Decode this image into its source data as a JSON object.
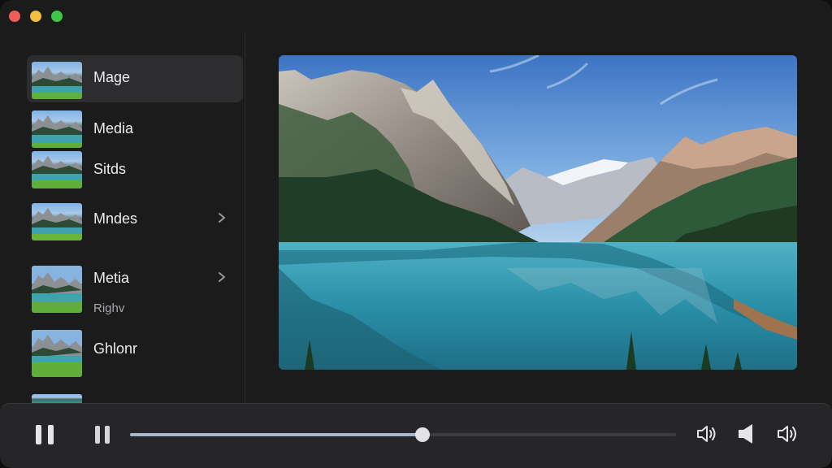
{
  "sidebar": {
    "items": [
      {
        "label": "Mage",
        "selected": true,
        "chevron": false,
        "thumb_icon": "mountain-lake-thumbnail"
      },
      {
        "label": "Media",
        "selected": false,
        "chevron": false,
        "thumb_icon": "mountain-lake-thumbnail"
      },
      {
        "label": "Sitds",
        "selected": false,
        "chevron": false,
        "thumb_icon": "mountain-lake-thumbnail"
      },
      {
        "label": "Mndes",
        "selected": false,
        "chevron": true,
        "thumb_icon": "mountain-lake-thumbnail"
      },
      {
        "label": "Metia",
        "sublabel": "Righv",
        "selected": false,
        "chevron": true,
        "thumb_icon": "mountain-lake-thumbnail"
      },
      {
        "label": "Ghlonr",
        "selected": false,
        "chevron": false,
        "thumb_icon": "mountain-lake-thumbnail"
      }
    ],
    "chevron_icon": "chevron-right-icon"
  },
  "viewer": {
    "image": "mountain-lake-landscape"
  },
  "player": {
    "progress": 0.536,
    "icons": [
      "play-pause-icon",
      "pause-icon",
      "volume-low-icon",
      "speaker-icon",
      "volume-high-icon"
    ]
  },
  "colors": {
    "window_bg": "#1b1b1c",
    "selected_bg": "#2d2d2f",
    "control_bar": "#262628",
    "seek_fill": "#a7b6cf",
    "close": "#ee5f58",
    "minimize": "#f5bd42",
    "maximize": "#3fc64a"
  }
}
